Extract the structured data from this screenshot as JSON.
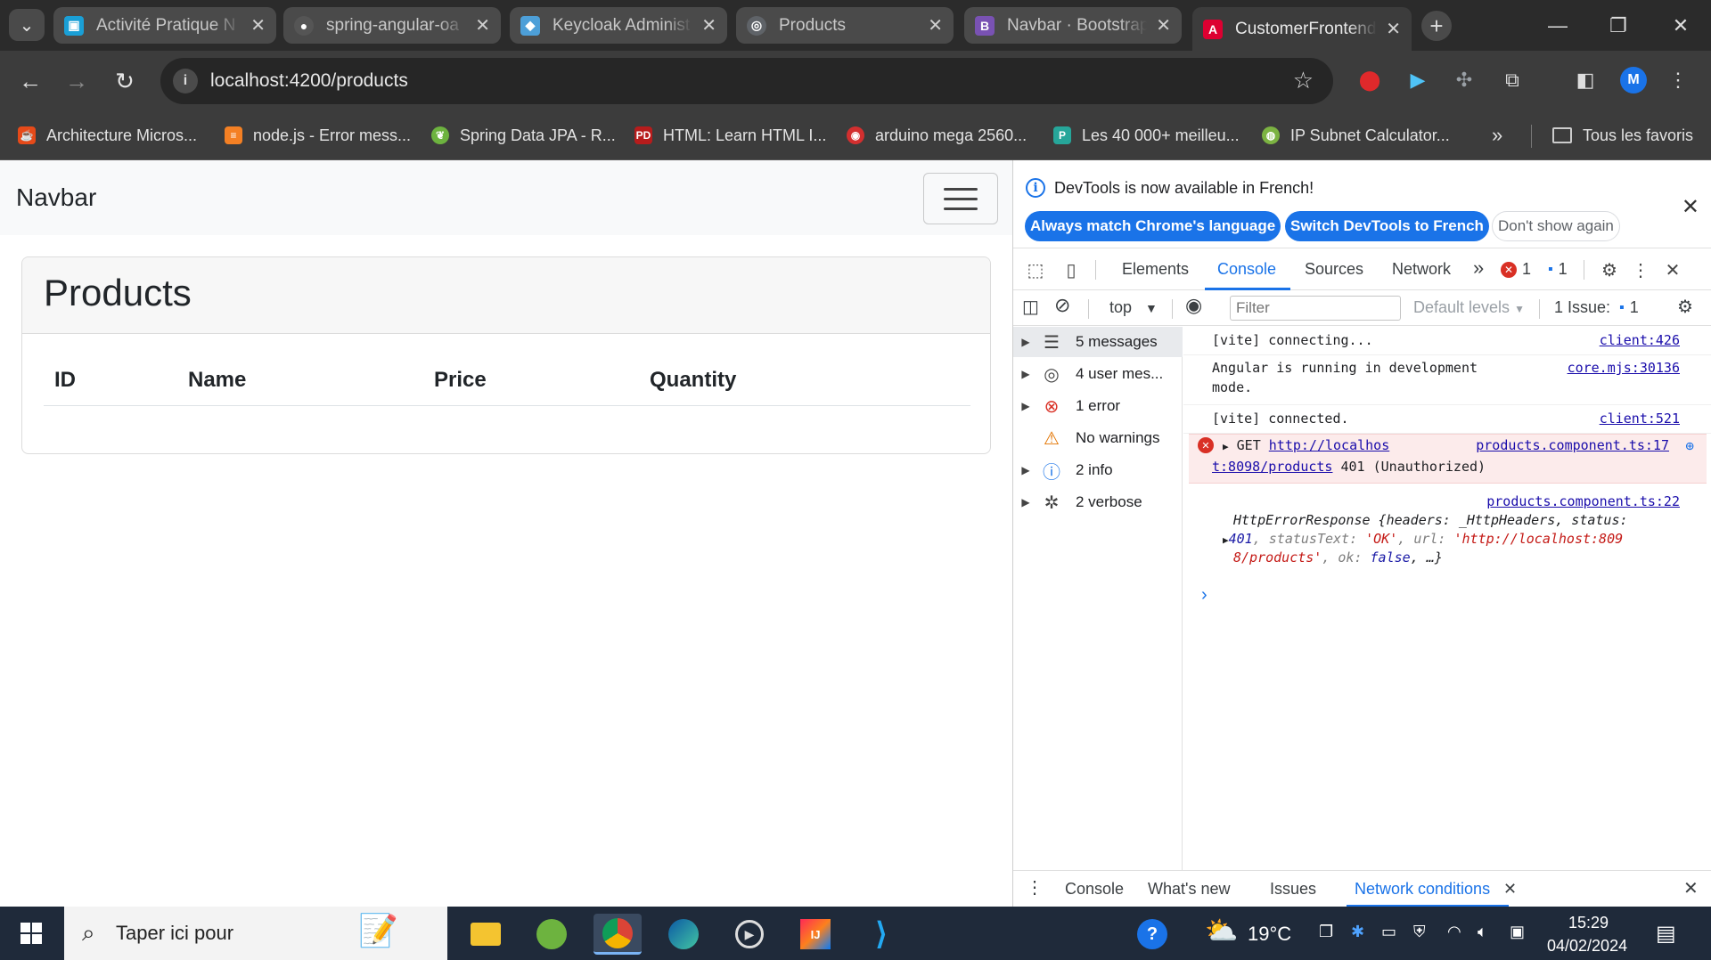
{
  "browser": {
    "tabs": [
      {
        "title": "Activité Pratique N",
        "favicon_color": "#1a9fd6",
        "active": false
      },
      {
        "title": "spring-angular-oa",
        "favicon_color": "#555555",
        "active": false
      },
      {
        "title": "Keycloak Administ",
        "favicon_color": "#4d9fd8",
        "active": false
      },
      {
        "title": "Products",
        "favicon_color": "#5f6368",
        "active": false
      },
      {
        "title": "Navbar · Bootstrap",
        "favicon_color": "#7952b3",
        "favicon_letter": "B",
        "active": false
      },
      {
        "title": "CustomerFrontend",
        "favicon_color": "#dd0031",
        "active": true
      }
    ],
    "url": "localhost:4200/products",
    "profile_initial": "M",
    "bookmarks": [
      "Architecture Micros...",
      "node.js - Error mess...",
      "Spring Data JPA - R...",
      "HTML: Learn HTML I...",
      "arduino mega 2560...",
      "Les 40 000+ meilleu...",
      "IP Subnet Calculator..."
    ],
    "bookmarks_more": "»",
    "all_bookmarks": "Tous les favoris"
  },
  "page": {
    "navbar_brand": "Navbar",
    "card_title": "Products",
    "table_headers": [
      "ID",
      "Name",
      "Price",
      "Quantity"
    ]
  },
  "devtools": {
    "banner_message": "DevTools is now available in French!",
    "btn_match": "Always match Chrome's language",
    "btn_switch": "Switch DevTools to French",
    "btn_dont_show": "Don't show again",
    "tabs": [
      "Elements",
      "Console",
      "Sources",
      "Network"
    ],
    "more_tabs": "»",
    "error_count": "1",
    "message_count": "1",
    "context": "top",
    "filter_placeholder": "Filter",
    "default_levels": "Default levels",
    "issues_label": "1 Issue:",
    "issues_count": "1",
    "sidebar": [
      {
        "label": "5 messages",
        "icon": "list-icon"
      },
      {
        "label": "4 user mes...",
        "icon": "user-icon"
      },
      {
        "label": "1 error",
        "icon": "error-icon"
      },
      {
        "label": "No warnings",
        "icon": "warning-icon"
      },
      {
        "label": "2 info",
        "icon": "info-icon"
      },
      {
        "label": "2 verbose",
        "icon": "bug-icon"
      }
    ],
    "logs": {
      "l1_text": "[vite] connecting...",
      "l1_src": "client:426",
      "l2_text_a": "Angular is running in development",
      "l2_text_b": "mode.",
      "l2_src": "core.mjs:30136",
      "l3_text": "[vite] connected.",
      "l3_src": "client:521",
      "err_method": "GET",
      "err_url_a": "http://localhos",
      "err_url_b": "t:8098/products",
      "err_status": "401 (Unauthorized)",
      "err_src": "products.component.ts:17",
      "l5_src": "products.component.ts:22",
      "l5_line1": "HttpErrorResponse {headers: _HttpHeaders, status:",
      "l5_status": "401",
      "l5_statusText": "'OK'",
      "l5_url_a": "'http://localhost:809",
      "l5_url_b": "8/products'",
      "l5_ok": "false",
      "prompt": "›"
    },
    "drawer_tabs": [
      "Console",
      "What's new",
      "Issues",
      "Network conditions"
    ]
  },
  "taskbar": {
    "search_placeholder": "Taper ici pour",
    "temperature": "19°C",
    "time": "15:29",
    "date": "04/02/2024"
  }
}
